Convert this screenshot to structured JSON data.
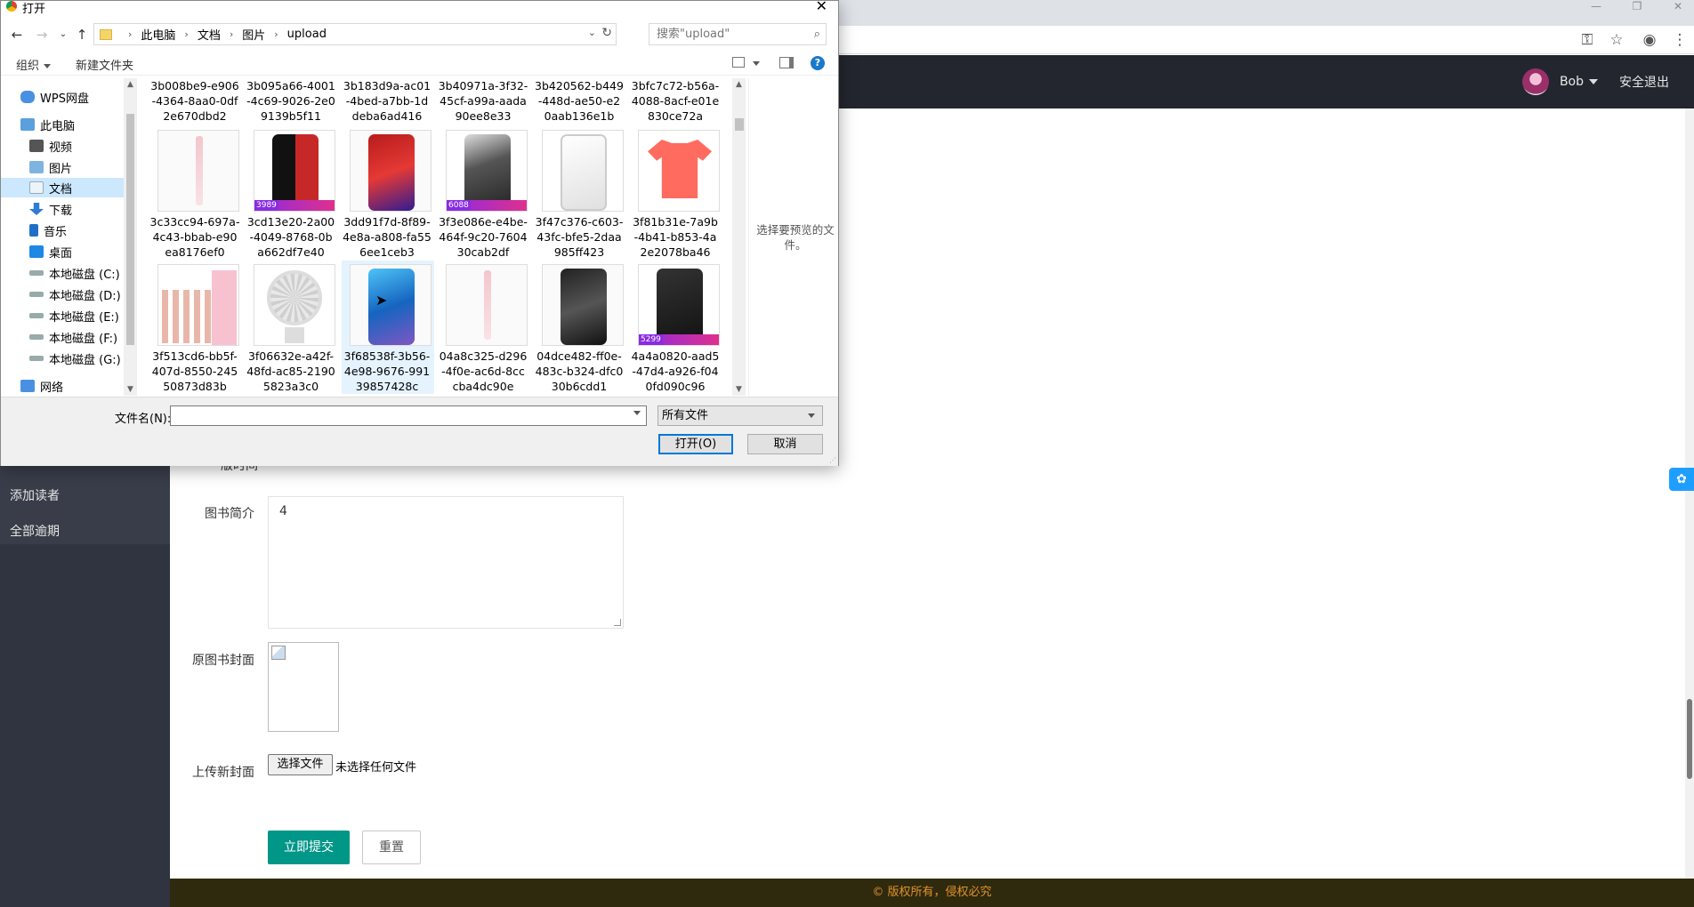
{
  "app": {
    "user_name": "Bob",
    "logout": "安全退出",
    "sidebar_items": [
      "添加读者",
      "全部逾期"
    ],
    "footer": "© 版权所有，侵权必究"
  },
  "form": {
    "partial_label": "版时间",
    "intro_label": "图书简介",
    "intro_value": "4",
    "old_cover_label": "原图书封面",
    "new_cover_label": "上传新封面",
    "choose_file": "选择文件",
    "no_file": "未选择任何文件",
    "submit": "立即提交",
    "reset": "重置"
  },
  "dialog": {
    "title": "打开",
    "breadcrumb": [
      "此电脑",
      "文档",
      "图片",
      "upload"
    ],
    "search_placeholder": "搜索\"upload\"",
    "toolbar": {
      "organize": "组织",
      "new_folder": "新建文件夹"
    },
    "nav_items": [
      {
        "label": "WPS网盘",
        "icon": "cloud-icon"
      },
      {
        "label": "此电脑",
        "icon": "computer-icon"
      },
      {
        "label": "视频",
        "icon": "video-folder-icon"
      },
      {
        "label": "图片",
        "icon": "pictures-folder-icon"
      },
      {
        "label": "文档",
        "icon": "documents-folder-icon",
        "selected": true
      },
      {
        "label": "下载",
        "icon": "download-folder-icon"
      },
      {
        "label": "音乐",
        "icon": "music-folder-icon"
      },
      {
        "label": "桌面",
        "icon": "desktop-folder-icon"
      },
      {
        "label": "本地磁盘 (C:)",
        "icon": "drive-icon"
      },
      {
        "label": "本地磁盘 (D:)",
        "icon": "drive-icon"
      },
      {
        "label": "本地磁盘 (E:)",
        "icon": "drive-icon"
      },
      {
        "label": "本地磁盘 (F:)",
        "icon": "drive-icon"
      },
      {
        "label": "本地磁盘 (G:)",
        "icon": "drive-icon"
      },
      {
        "label": "网络",
        "icon": "network-icon"
      }
    ],
    "top_partial_files": [
      "3b008be9-e906\n-4364-8aa0-0df\n2e670dbd2",
      "3b095a66-4001\n-4c69-9026-2e0\n9139b5f11",
      "3b183d9a-ac01\n-4bed-a7bb-1d\ndeba6ad416",
      "3b40971a-3f32-\n45cf-a99a-aada\n90ee8e33",
      "3b420562-b449\n-448d-ae50-e2\n0aab136e1b",
      "3bfc7c72-b56a-\n4088-8acf-e01e\n830ce72a"
    ],
    "files_row1": [
      {
        "name": "3c33cc94-697a-\n4c43-bbab-e90\nea8176ef0",
        "thumb": "pen-pink"
      },
      {
        "name": "3cd13e20-2a00\n-4049-8768-0b\na662df7e40",
        "thumb": "phone-black-red",
        "price": "3989"
      },
      {
        "name": "3dd91f7d-8f89-\n4e8a-a808-fa55\n6ee1ceb3",
        "thumb": "phone-red"
      },
      {
        "name": "3f3e086e-e4be-\n464f-9c20-7604\n30cab2df",
        "thumb": "iphone-xsmax",
        "price": "6088"
      },
      {
        "name": "3f47c376-c603-\n43fc-bfe5-2daa\n985ff423",
        "thumb": "iphone-xr-white"
      },
      {
        "name": "3f81b31e-7a9b\n-4b41-b853-4a\n2e2078ba46",
        "thumb": "tshirt-coral"
      }
    ],
    "files_row2": [
      {
        "name": "3f513cd6-bb5f-\n407d-8550-245\n50873d83b",
        "thumb": "lipstick-set"
      },
      {
        "name": "3f06632e-a42f-\n48fd-ac85-2190\n5823a3c0",
        "thumb": "desk-fan"
      },
      {
        "name": "3f68538f-3b56-\n4e98-9676-991\n39857428c",
        "thumb": "phone-blue",
        "hover": true
      },
      {
        "name": "04a8c325-d296\n-4f0e-ac6d-8cc\ncba4dc90e",
        "thumb": "pen-pink"
      },
      {
        "name": "04dce482-ff0e-\n483c-b324-dfc0\n30b6cdd1",
        "thumb": "phone-black-model"
      },
      {
        "name": "4a4a0820-aad5\n-47d4-a926-f04\n0fd090c96",
        "thumb": "iphone-xs",
        "price": "5299"
      }
    ],
    "preview_text": "选择要预览的文件。",
    "filename_label": "文件名(N):",
    "filename_value": "",
    "file_type": "所有文件",
    "open_button": "打开(O)",
    "cancel_button": "取消"
  },
  "colors": {
    "header_bg": "#23262e",
    "sidebar_bg": "#393d49",
    "submit_bg": "#009688",
    "footer_text": "#e0922a",
    "selection": "#cce8ff"
  }
}
